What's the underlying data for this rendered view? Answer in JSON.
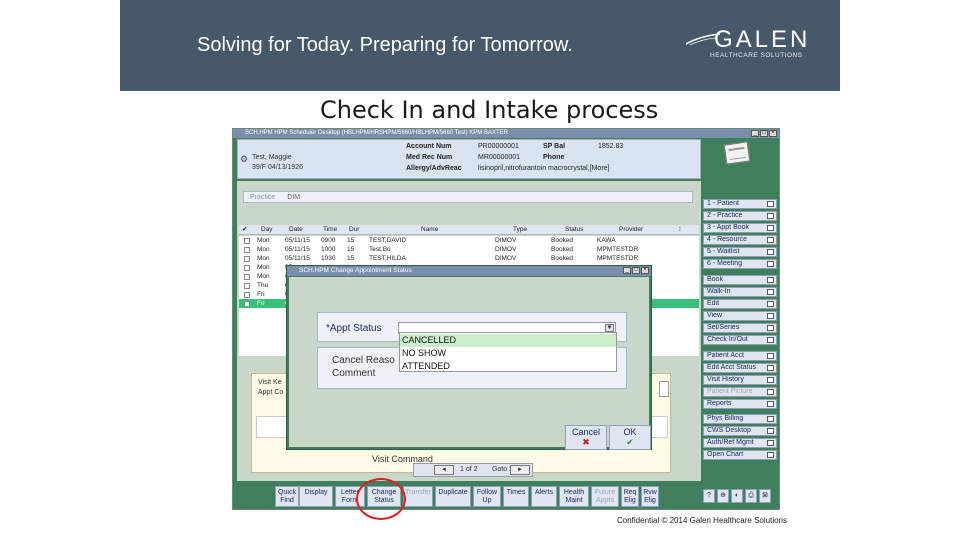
{
  "banner": {
    "tagline": "Solving for Today. Preparing for Tomorrow.",
    "logo_word": "GALEN",
    "logo_sub": "HEALTHCARE SOLUTIONS",
    "color": "#46596b"
  },
  "slide_title": "Check In and Intake process",
  "app": {
    "title": "SCH.HPM  HPM Scheduler Desktop  (HBLHPM/HRSHPM/5660/HBLHPM/5660  Test)  KPM BAXTER",
    "patient": {
      "name": "Test, Maggie",
      "age_dob": "39/F  04/13/1926",
      "account_num_label": "Account Num",
      "account_num": "PR00000001",
      "sp_bal_label": "SP Bal",
      "sp_bal": "1852.83",
      "med_rec_label": "Med Rec Num",
      "med_rec": "MR00000001",
      "phone_label": "Phone",
      "phone": "",
      "allergy_label": "Allergy/AdvReac",
      "allergy": "lisinopril,nitrofurantoin macrocrystal,[More]"
    },
    "practice_label": "Practice",
    "practice_value": "DIM",
    "grid_headers": [
      "Day",
      "Date",
      "Time",
      "Dur",
      "Name",
      "Type",
      "Status",
      "Provider"
    ],
    "rows": [
      {
        "day": "Mon",
        "date": "05/11/15",
        "time": "0900",
        "dur": "15",
        "name": "TEST,DAVID",
        "type": "DIMOV",
        "status": "Booked",
        "provider": "KAWA"
      },
      {
        "day": "Mon",
        "date": "05/11/15",
        "time": "1000",
        "dur": "15",
        "name": "Test,Bo",
        "type": "DIMOV",
        "status": "Booked",
        "provider": "MPMTESTDR"
      },
      {
        "day": "Mon",
        "date": "05/11/15",
        "time": "1030",
        "dur": "15",
        "name": "TEST,HILDA",
        "type": "DIMOV",
        "status": "Booked",
        "provider": "MPMTESTDR"
      },
      {
        "day": "Mon",
        "date": "05",
        "time": "",
        "dur": "",
        "name": "",
        "type": "",
        "status": "",
        "provider": ""
      },
      {
        "day": "Mon",
        "date": "05",
        "time": "",
        "dur": "",
        "name": "",
        "type": "",
        "status": "",
        "provider": ""
      },
      {
        "day": "Thu",
        "date": "05",
        "time": "",
        "dur": "",
        "name": "",
        "type": "",
        "status": "",
        "provider": ""
      },
      {
        "day": "Fri",
        "date": "05",
        "time": "",
        "dur": "",
        "name": "",
        "type": "",
        "status": "",
        "provider": ""
      },
      {
        "day": "Fri",
        "date": "05",
        "time": "",
        "dur": "",
        "name": "",
        "type": "",
        "status": "",
        "provider": "",
        "selected": true
      }
    ],
    "visit": {
      "visit_key": "Visit Ke",
      "appt": "Appt Co",
      "visit_command": "Visit Command"
    },
    "pager": {
      "text": "1 of 2",
      "goto": "Goto 2"
    },
    "right_menu": [
      {
        "label": "1 - Patient",
        "enabled": true
      },
      {
        "label": "2 - Practice",
        "enabled": true
      },
      {
        "label": "3 - Appt Book",
        "enabled": true
      },
      {
        "label": "4 - Resource",
        "enabled": true
      },
      {
        "label": "5 - Waitlist",
        "enabled": true
      },
      {
        "label": "6 - Meeting",
        "enabled": true
      },
      {
        "label": "Book",
        "enabled": true
      },
      {
        "label": "Walk-In",
        "enabled": true
      },
      {
        "label": "Edit",
        "enabled": true
      },
      {
        "label": "View",
        "enabled": true
      },
      {
        "label": "Set/Series",
        "enabled": true
      },
      {
        "label": "Check In/Out",
        "enabled": true
      },
      {
        "label": "Patient Acct",
        "enabled": true
      },
      {
        "label": "Edit Acct Status",
        "enabled": true
      },
      {
        "label": "Visit History",
        "enabled": true
      },
      {
        "label": "Patient Picture",
        "enabled": false
      },
      {
        "label": "Reports",
        "enabled": true
      },
      {
        "label": "Phys Billing",
        "enabled": true
      },
      {
        "label": "CWS Desktop",
        "enabled": true
      },
      {
        "label": "Auth/Ref Mgmt",
        "enabled": true
      },
      {
        "label": "Open Chart",
        "enabled": true
      }
    ],
    "toolbar": [
      {
        "l1": "Quick",
        "l2": "Find",
        "enabled": true
      },
      {
        "l1": "Display",
        "l2": "",
        "enabled": true
      },
      {
        "l1": "Letter",
        "l2": "Form",
        "enabled": true
      },
      {
        "l1": "Change",
        "l2": "Status",
        "enabled": true
      },
      {
        "l1": "Transfer",
        "l2": "",
        "enabled": false
      },
      {
        "l1": "Duplicate",
        "l2": "",
        "enabled": true
      },
      {
        "l1": "Follow",
        "l2": "Up",
        "enabled": true
      },
      {
        "l1": "Times",
        "l2": "",
        "enabled": true
      },
      {
        "l1": "Alerts",
        "l2": "",
        "enabled": true
      },
      {
        "l1": "Health",
        "l2": "Maint",
        "enabled": true
      },
      {
        "l1": "Future",
        "l2": "Appts",
        "enabled": false
      },
      {
        "l1": "Req",
        "l2": "Elig",
        "enabled": true
      },
      {
        "l1": "Rvw",
        "l2": "Elig",
        "enabled": true
      }
    ],
    "toolbar_icons": [
      "?",
      "⊕",
      "◐",
      "⎙",
      "⊠"
    ]
  },
  "dialog": {
    "title": "SCH.HPM  Change Appointment Status",
    "status_label": "*Appt Status",
    "status_value": "",
    "reason_label": "Cancel Reaso",
    "comment_label": "Comment",
    "options": [
      "CANCELLED",
      "NO SHOW",
      "ATTENDED"
    ],
    "cancel": "Cancel",
    "ok": "OK"
  },
  "footer": "Confidential © 2014 Galen Healthcare Solutions",
  "colors": {
    "app_bg": "#3f7f5c",
    "panel_bg": "#c8d7c8",
    "highlight_circle": "#e02020",
    "selected_row": "#39c07a"
  }
}
